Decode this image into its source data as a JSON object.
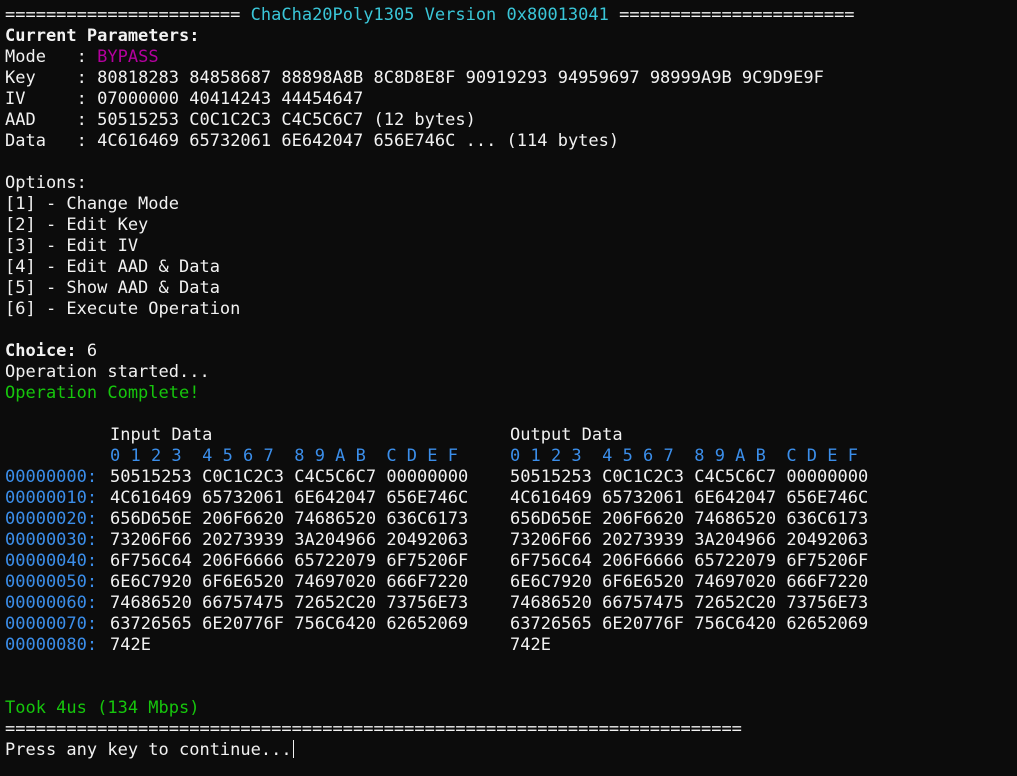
{
  "header": {
    "left_rule": "=======================",
    "title": "ChaCha20Poly1305 Version 0x80013041",
    "right_rule": "======================="
  },
  "params": {
    "heading": "Current Parameters:",
    "rows": [
      {
        "label": "Mode   ",
        "value": "BYPASS"
      },
      {
        "label": "Key    ",
        "value": "80818283 84858687 88898A8B 8C8D8E8F 90919293 94959697 98999A9B 9C9D9E9F"
      },
      {
        "label": "IV     ",
        "value": "07000000 40414243 44454647"
      },
      {
        "label": "AAD    ",
        "value": "50515253 C0C1C2C3 C4C5C6C7 (12 bytes)"
      },
      {
        "label": "Data   ",
        "value": "4C616469 65732061 6E642047 656E746C ... (114 bytes)"
      }
    ],
    "separator": ": "
  },
  "options": {
    "heading": "Options:",
    "items": [
      "[1] - Change Mode",
      "[2] - Edit Key",
      "[3] - Edit IV",
      "[4] - Edit AAD & Data",
      "[5] - Show AAD & Data",
      "[6] - Execute Operation"
    ]
  },
  "prompt": {
    "choice_label": "Choice:",
    "choice_value": " 6",
    "started": "Operation started...",
    "complete": "Operation Complete!"
  },
  "dump": {
    "input_title": "Input Data",
    "output_title": "Output Data",
    "hex_header": "0 1 2 3  4 5 6 7  8 9 A B  C D E F",
    "rows": [
      {
        "addr": "00000000:",
        "input": "50515253 C0C1C2C3 C4C5C6C7 00000000",
        "output": "50515253 C0C1C2C3 C4C5C6C7 00000000"
      },
      {
        "addr": "00000010:",
        "input": "4C616469 65732061 6E642047 656E746C",
        "output": "4C616469 65732061 6E642047 656E746C"
      },
      {
        "addr": "00000020:",
        "input": "656D656E 206F6620 74686520 636C6173",
        "output": "656D656E 206F6620 74686520 636C6173"
      },
      {
        "addr": "00000030:",
        "input": "73206F66 20273939 3A204966 20492063",
        "output": "73206F66 20273939 3A204966 20492063"
      },
      {
        "addr": "00000040:",
        "input": "6F756C64 206F6666 65722079 6F75206F",
        "output": "6F756C64 206F6666 65722079 6F75206F"
      },
      {
        "addr": "00000050:",
        "input": "6E6C7920 6F6E6520 74697020 666F7220",
        "output": "6E6C7920 6F6E6520 74697020 666F7220"
      },
      {
        "addr": "00000060:",
        "input": "74686520 66757475 72652C20 73756E73",
        "output": "74686520 66757475 72652C20 73756E73"
      },
      {
        "addr": "00000070:",
        "input": "63726565 6E20776F 756C6420 62652069",
        "output": "63726565 6E20776F 756C6420 62652069"
      },
      {
        "addr": "00000080:",
        "input": "742E",
        "output": "742E"
      }
    ]
  },
  "footer": {
    "timing": "Took 4us (134 Mbps)",
    "rule": "========================================================================",
    "press": "Press any key to continue..."
  },
  "colors": {
    "background": "#0c0c0c",
    "text": "#f2f2f2",
    "title_cyan": "#3ac6d8",
    "mode_magenta": "#b4009e",
    "success_green": "#16c60c",
    "address_blue": "#3b8eea"
  }
}
